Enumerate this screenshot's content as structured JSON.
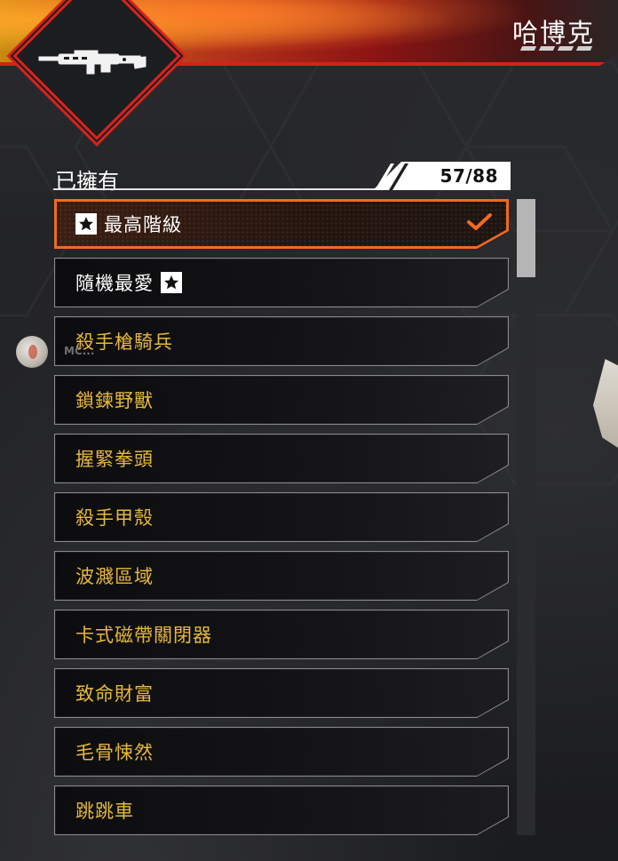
{
  "header": {
    "character_name": "哈博克",
    "weapon_icon": "weapon-icon"
  },
  "collection": {
    "owned_label": "已擁有",
    "count": "57/88"
  },
  "skins": [
    {
      "label": "最高階級",
      "rarity_color": "#ffffff",
      "selected": true,
      "icon_before": "star-badge-icon"
    },
    {
      "label": "隨機最愛",
      "rarity_color": "#ffffff",
      "selected": false,
      "icon_after": "star-badge-icon"
    },
    {
      "label": "殺手槍騎兵",
      "rarity_color": "#e7b83c",
      "selected": false
    },
    {
      "label": "鎖鍊野獸",
      "rarity_color": "#e7b83c",
      "selected": false
    },
    {
      "label": "握緊拳頭",
      "rarity_color": "#e7b83c",
      "selected": false
    },
    {
      "label": "殺手甲殼",
      "rarity_color": "#e7b83c",
      "selected": false
    },
    {
      "label": "波濺區域",
      "rarity_color": "#e7b83c",
      "selected": false
    },
    {
      "label": "卡式磁帶關閉器",
      "rarity_color": "#e7b83c",
      "selected": false
    },
    {
      "label": "致命財富",
      "rarity_color": "#e7b83c",
      "selected": false
    },
    {
      "label": "毛骨悚然",
      "rarity_color": "#e7b83c",
      "selected": false
    },
    {
      "label": "跳跳車",
      "rarity_color": "#e7b83c",
      "selected": false
    }
  ],
  "side_user": {
    "name": "MC..."
  },
  "colors": {
    "accent_red": "#d8231c",
    "selected_orange": "#f26a21",
    "legendary_gold": "#e7b83c"
  }
}
